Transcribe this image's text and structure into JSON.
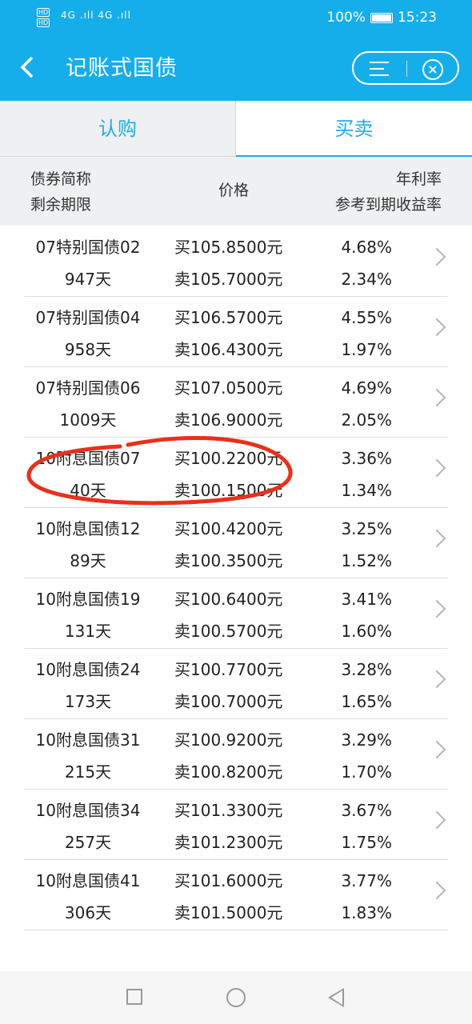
{
  "status": {
    "hd1": "HD",
    "hd2": "HD",
    "signal": "4G .ıll 4G .ıll",
    "battery": "100%",
    "time": "15:23"
  },
  "header_bar": {
    "back_glyph": "‹",
    "title": "记账式国债",
    "close_glyph": "×"
  },
  "tabs": [
    {
      "label": "认购"
    },
    {
      "label": "买卖"
    }
  ],
  "table_header": {
    "col1_line1": "债券简称",
    "col1_line2": "剩余期限",
    "col2": "价格",
    "col3_line1": "年利率",
    "col3_line2": "参考到期收益率"
  },
  "rows": [
    {
      "name": "07特别国债02",
      "days": "947天",
      "buy": "买105.8500元",
      "sell": "卖105.7000元",
      "rate": "4.68%",
      "yield": "2.34%"
    },
    {
      "name": "07特别国债04",
      "days": "958天",
      "buy": "买106.5700元",
      "sell": "卖106.4300元",
      "rate": "4.55%",
      "yield": "1.97%"
    },
    {
      "name": "07特别国债06",
      "days": "1009天",
      "buy": "买107.0500元",
      "sell": "卖106.9000元",
      "rate": "4.69%",
      "yield": "2.05%"
    },
    {
      "name": "10附息国债07",
      "days": "40天",
      "buy": "买100.2200元",
      "sell": "卖100.1500元",
      "rate": "3.36%",
      "yield": "1.34%"
    },
    {
      "name": "10附息国债12",
      "days": "89天",
      "buy": "买100.4200元",
      "sell": "卖100.3500元",
      "rate": "3.25%",
      "yield": "1.52%"
    },
    {
      "name": "10附息国债19",
      "days": "131天",
      "buy": "买100.6400元",
      "sell": "卖100.5700元",
      "rate": "3.41%",
      "yield": "1.60%"
    },
    {
      "name": "10附息国债24",
      "days": "173天",
      "buy": "买100.7700元",
      "sell": "卖100.7000元",
      "rate": "3.28%",
      "yield": "1.65%"
    },
    {
      "name": "10附息国债31",
      "days": "215天",
      "buy": "买100.9200元",
      "sell": "卖100.8200元",
      "rate": "3.29%",
      "yield": "1.70%"
    },
    {
      "name": "10附息国债34",
      "days": "257天",
      "buy": "买101.3300元",
      "sell": "卖101.2300元",
      "rate": "3.67%",
      "yield": "1.75%"
    },
    {
      "name": "10附息国债41",
      "days": "306天",
      "buy": "买101.6000元",
      "sell": "卖101.5000元",
      "rate": "3.77%",
      "yield": "1.83%"
    }
  ],
  "colors": {
    "accent": "#16aeea",
    "annotation": "#e8301c"
  }
}
